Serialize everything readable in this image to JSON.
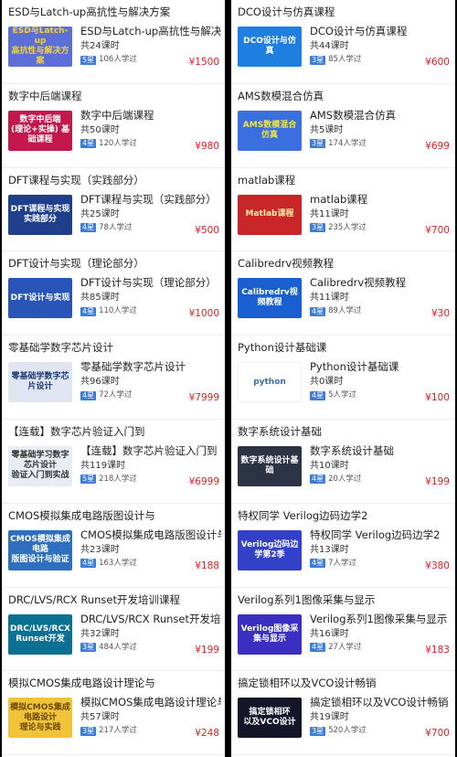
{
  "left": [
    {
      "title": "ESD与Latch-up高抗性与解决方案",
      "name": "ESD与Latch-up高抗性与解决方案",
      "hours": "共24课时",
      "level": "5星",
      "learners": "106人学过",
      "price": "¥1500",
      "thumb_text": "ESD与Latch-up\n高抗性与解决方案",
      "thumb_bg": "#5b6fd6",
      "thumb_fg": "#f2d23a"
    },
    {
      "title": "数字中后端课程",
      "name": "数字中后端课程",
      "hours": "共50课时",
      "level": "4星",
      "learners": "120人学过",
      "price": "¥980",
      "thumb_text": "数字中后端\n(理论+实操) 基础课程",
      "thumb_bg": "#c4184d",
      "thumb_fg": "#ffffff"
    },
    {
      "title": "DFT课程与实现（实践部分）",
      "name": "DFT课程与实现（实践部分）",
      "hours": "共25课时",
      "level": "4星",
      "learners": "78人学过",
      "price": "¥500",
      "thumb_text": "DFT课程与实现\n实践部分",
      "thumb_bg": "#1f3e8c",
      "thumb_fg": "#ffffff"
    },
    {
      "title": "DFT设计与实现（理论部分）",
      "name": "DFT设计与实现（理论部分）",
      "hours": "共85课时",
      "level": "4星",
      "learners": "110人学过",
      "price": "¥1000",
      "thumb_text": "DFT设计与实现",
      "thumb_bg": "#2a55b8",
      "thumb_fg": "#ffffff"
    },
    {
      "title": "零基础学数字芯片设计",
      "name": "零基础学数字芯片设计",
      "hours": "共96课时",
      "level": "4星",
      "learners": "72人学过",
      "price": "¥7999",
      "thumb_text": "零基础学数字芯片设计",
      "thumb_bg": "#dfe6f2",
      "thumb_fg": "#1e3a78"
    },
    {
      "title": "【连载】数字芯片验证入门到",
      "name": "【连载】数字芯片验证入门到",
      "hours": "共119课时",
      "level": "5星",
      "learners": "218人学过",
      "price": "¥6999",
      "thumb_text": "零基础学习数字芯片设计\n验证入门到实战",
      "thumb_bg": "#e8ecf4",
      "thumb_fg": "#333333"
    },
    {
      "title": "CMOS模拟集成电路版图设计与",
      "name": "CMOS模拟集成电路版图设计与",
      "hours": "共23课时",
      "level": "4星",
      "learners": "163人学过",
      "price": "¥188",
      "thumb_text": "CMOS模拟集成电路\n版图设计与验证",
      "thumb_bg": "#2f6fbf",
      "thumb_fg": "#ffffff"
    },
    {
      "title": "DRC/LVS/RCX Runset开发培训课程",
      "name": "DRC/LVS/RCX Runset开发培...",
      "hours": "共32课时",
      "level": "3星",
      "learners": "484人学过",
      "price": "¥199",
      "thumb_text": "DRC/LVS/RCX Runset开发",
      "thumb_bg": "#0c6f94",
      "thumb_fg": "#ffffff"
    },
    {
      "title": "模拟CMOS集成电路设计理论与",
      "name": "模拟CMOS集成电路设计理论与",
      "hours": "共57课时",
      "level": "3星",
      "learners": "217人学过",
      "price": "¥248",
      "thumb_text": "模拟CMOS集成电路设计\n理论与实践",
      "thumb_bg": "#f1c33a",
      "thumb_fg": "#6a4a00"
    }
  ],
  "right": [
    {
      "title": "DCO设计与仿真课程",
      "name": "DCO设计与仿真课程",
      "hours": "共44课时",
      "level": "3星",
      "learners": "85人学过",
      "price": "¥600",
      "thumb_text": "DCO设计与仿真",
      "thumb_bg": "#1f7fe0",
      "thumb_fg": "#ffffff"
    },
    {
      "title": "AMS数模混合仿真",
      "name": "AMS数模混合仿真",
      "hours": "共5课时",
      "level": "3星",
      "learners": "174人学过",
      "price": "¥699",
      "thumb_text": "AMS数模混合\n仿真",
      "thumb_bg": "#3b6fe0",
      "thumb_fg": "#f5e63a"
    },
    {
      "title": "matlab课程",
      "name": "matlab课程",
      "hours": "共11课时",
      "level": "3星",
      "learners": "235人学过",
      "price": "¥700",
      "thumb_text": "Matlab课程",
      "thumb_bg": "#c9262a",
      "thumb_fg": "#fff2a8"
    },
    {
      "title": "Calibredrv视频教程",
      "name": "Calibredrv视频教程",
      "hours": "共11课时",
      "level": "4星",
      "learners": "89人学过",
      "price": "¥30",
      "thumb_text": "Calibredrv视频教程",
      "thumb_bg": "#1a5fd0",
      "thumb_fg": "#ffffff"
    },
    {
      "title": "Python设计基础课",
      "name": "Python设计基础课",
      "hours": "共0课时",
      "level": "4星",
      "learners": "5人学过",
      "price": "¥100",
      "thumb_text": "python",
      "thumb_bg": "#ffffff",
      "thumb_fg": "#3a6ea5"
    },
    {
      "title": "数字系统设计基础",
      "name": "数字系统设计基础",
      "hours": "共10课时",
      "level": "4星",
      "learners": "20人学过",
      "price": "¥199",
      "thumb_text": "数字系统设计基础",
      "thumb_bg": "#2c3344",
      "thumb_fg": "#ffffff"
    },
    {
      "title": "特权同学 Verilog边码边学2",
      "name": "特权同学 Verilog边码边学2",
      "hours": "共13课时",
      "level": "4星",
      "learners": "7人学过",
      "price": "¥380",
      "thumb_text": "Verilog边码边学第2季",
      "thumb_bg": "#3340c8",
      "thumb_fg": "#ffffff"
    },
    {
      "title": "Verilog系列1图像采集与显示",
      "name": "Verilog系列1图像采集与显示",
      "hours": "共16课时",
      "level": "4星",
      "learners": "27人学过",
      "price": "¥183",
      "thumb_text": "Verilog图像采集与显示",
      "thumb_bg": "#3a2fc0",
      "thumb_fg": "#ffffff"
    },
    {
      "title": "搞定锁相环以及VCO设计畅销",
      "name": "搞定锁相环以及VCO设计畅销",
      "hours": "共19课时",
      "level": "3星",
      "learners": "520人学过",
      "price": "¥700",
      "thumb_text": "搞定锁相环\n以及VCO设计",
      "thumb_bg": "#15152a",
      "thumb_fg": "#ffffff"
    }
  ]
}
